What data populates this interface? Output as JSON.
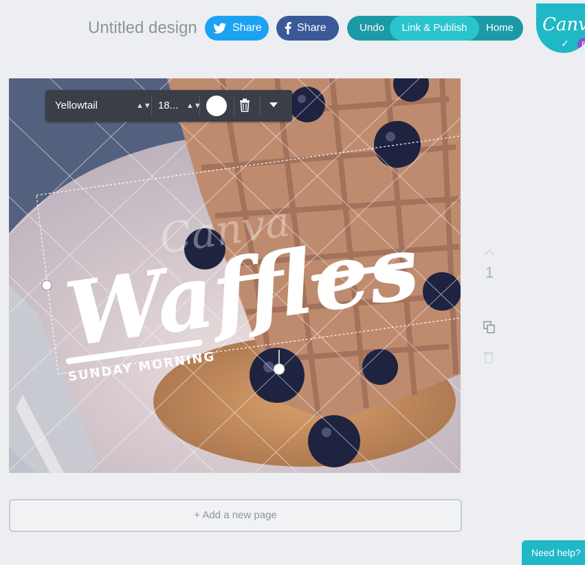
{
  "header": {
    "design_title": "Untitled design",
    "twitter_share": "Share",
    "facebook_share": "Share",
    "undo": "Undo",
    "link_publish": "Link & Publish",
    "home": "Home",
    "logo_text": "Canva",
    "badge": "P"
  },
  "text_toolbar": {
    "font_name": "Yellowtail",
    "font_size": "18..."
  },
  "design": {
    "headline": "Waffles",
    "subline": "SUNDAY MORNING",
    "watermark": "Canva"
  },
  "page_number": "1",
  "add_page": "+ Add a new page",
  "help": "Need help?",
  "colors": {
    "twitter": "#1da1f2",
    "facebook": "#3b5998",
    "teal": "#1b9aa6",
    "teal_active": "#2bc4cc",
    "toolbar": "#3a3f47"
  }
}
